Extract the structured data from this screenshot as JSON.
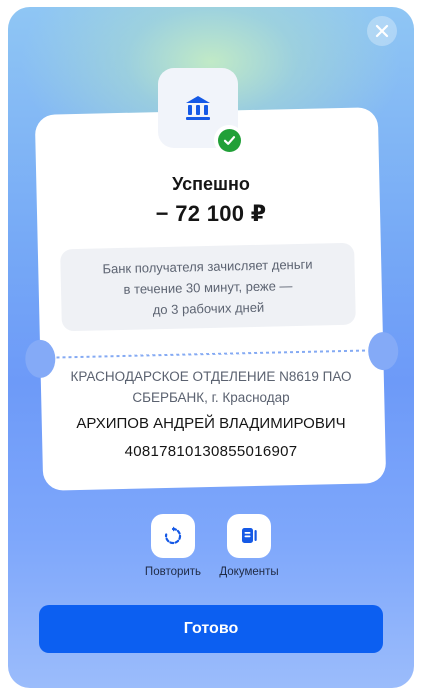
{
  "dialog": {
    "status_title": "Успешно",
    "amount": "− 72 100 ₽",
    "info_text": "Банк получателя зачисляет деньги\nв течение 30 минут, реже —\nдо 3 рабочих дней",
    "recipient": {
      "bank": "КРАСНОДАРСКОЕ ОТДЕЛЕНИЕ N8619 ПАО\nСБЕРБАНК, г. Краснодар",
      "name": "АРХИПОВ АНДРЕЙ ВЛАДИМИРОВИЧ",
      "account": "40817810130855016907"
    },
    "actions": [
      {
        "label": "Повторить",
        "icon": "repeat-icon"
      },
      {
        "label": "Документы",
        "icon": "documents-icon"
      }
    ],
    "done_label": "Готово"
  },
  "colors": {
    "primary_button": "#0c5ff1",
    "success": "#21a038",
    "icon_blue": "#1559e6"
  }
}
